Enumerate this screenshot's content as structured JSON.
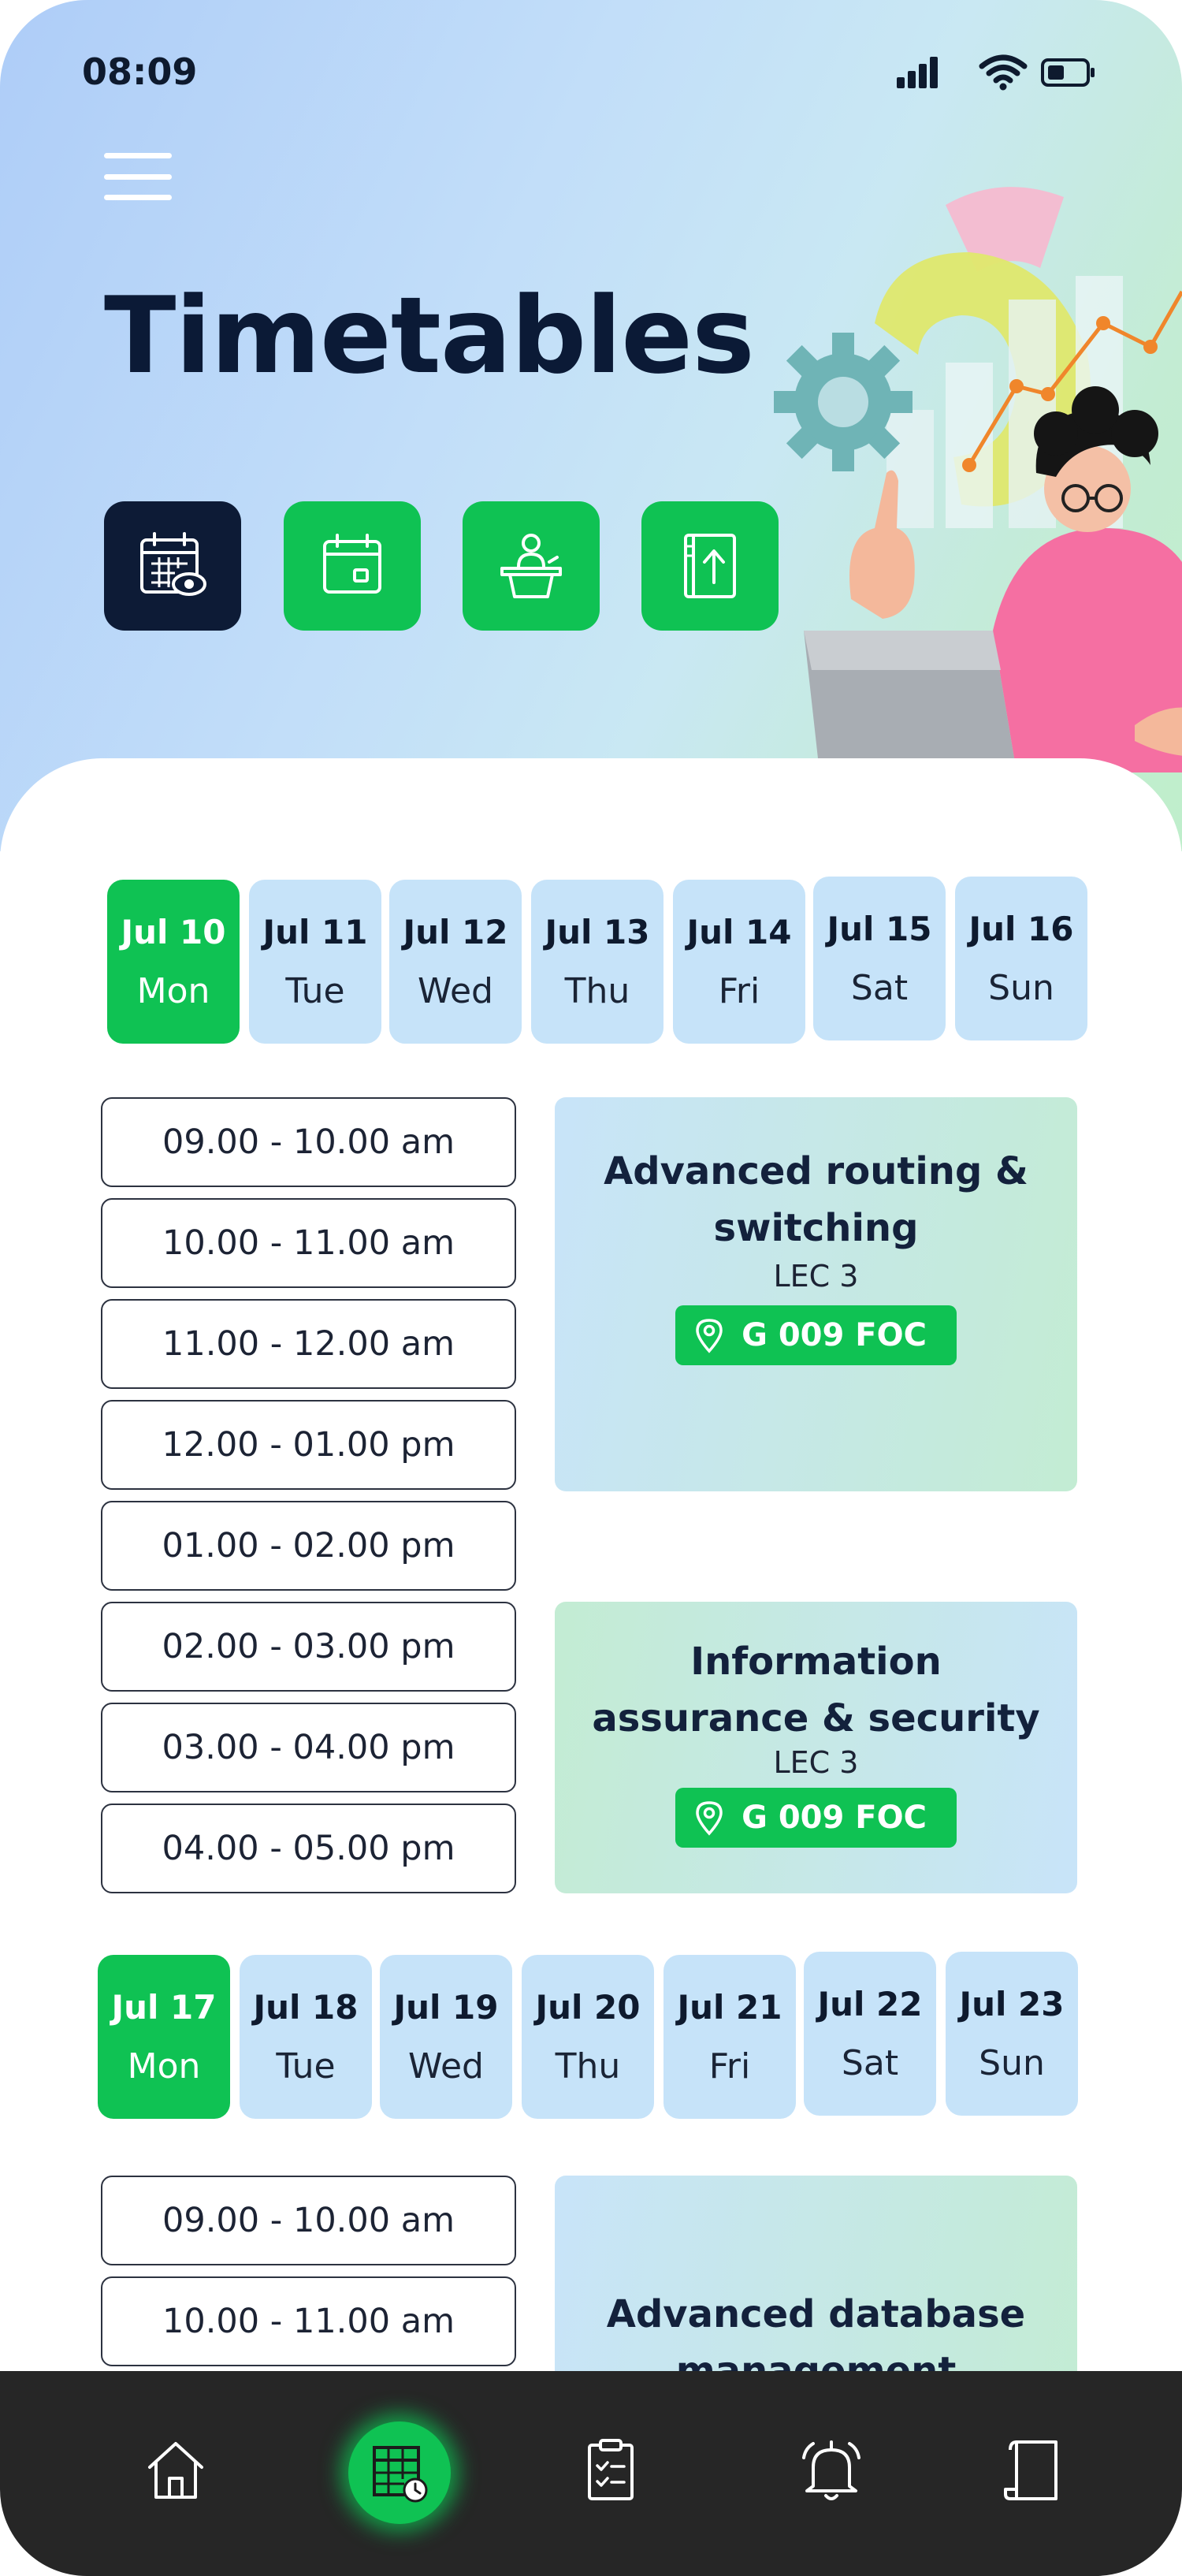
{
  "status_bar": {
    "time": "08:09"
  },
  "header": {
    "title": "Timetables"
  },
  "quick_actions": [
    {
      "icon": "calendar-view-icon"
    },
    {
      "icon": "calendar-icon"
    },
    {
      "icon": "lecturer-podium-icon"
    },
    {
      "icon": "book-upload-icon"
    }
  ],
  "weeks": [
    {
      "days": [
        {
          "date": "Jul 10",
          "day": "Mon",
          "active": true
        },
        {
          "date": "Jul 11",
          "day": "Tue"
        },
        {
          "date": "Jul 12",
          "day": "Wed"
        },
        {
          "date": "Jul 13",
          "day": "Thu"
        },
        {
          "date": "Jul 14",
          "day": "Fri"
        },
        {
          "date": "Jul 15",
          "day": "Sat"
        },
        {
          "date": "Jul 16",
          "day": "Sun"
        }
      ],
      "slots": [
        "09.00 - 10.00 am",
        "10.00 - 11.00 am",
        "11.00 - 12.00 am",
        "12.00 - 01.00 pm",
        "01.00 - 02.00 pm",
        "02.00 - 03.00 pm",
        "03.00 - 04.00 pm",
        "04.00 - 05.00 pm"
      ],
      "lectures": [
        {
          "title_line1": "Advanced routing &",
          "title_line2": "switching",
          "type": "LEC 3",
          "room": "G 009 FOC"
        },
        {
          "title_line1": "Information",
          "title_line2": "assurance & security",
          "type": "LEC 3",
          "room": "G 009 FOC"
        }
      ]
    },
    {
      "days": [
        {
          "date": "Jul 17",
          "day": "Mon",
          "active": true
        },
        {
          "date": "Jul 18",
          "day": "Tue"
        },
        {
          "date": "Jul 19",
          "day": "Wed"
        },
        {
          "date": "Jul 20",
          "day": "Thu"
        },
        {
          "date": "Jul 21",
          "day": "Fri"
        },
        {
          "date": "Jul 22",
          "day": "Sat"
        },
        {
          "date": "Jul 23",
          "day": "Sun"
        }
      ],
      "slots": [
        "09.00 - 10.00 am",
        "10.00 - 11.00 am"
      ],
      "lectures": [
        {
          "title_line1": "Advanced database",
          "title_line2": "management"
        }
      ]
    }
  ],
  "bottom_nav": [
    {
      "icon": "home-icon"
    },
    {
      "icon": "timetable-icon",
      "active": true
    },
    {
      "icon": "clipboard-icon"
    },
    {
      "icon": "bell-icon"
    },
    {
      "icon": "document-icon"
    }
  ],
  "colors": {
    "accent": "#0fc253",
    "dark": "#0d1b36",
    "day_bg": "#c6e3f9",
    "nav_bg": "#262626"
  }
}
